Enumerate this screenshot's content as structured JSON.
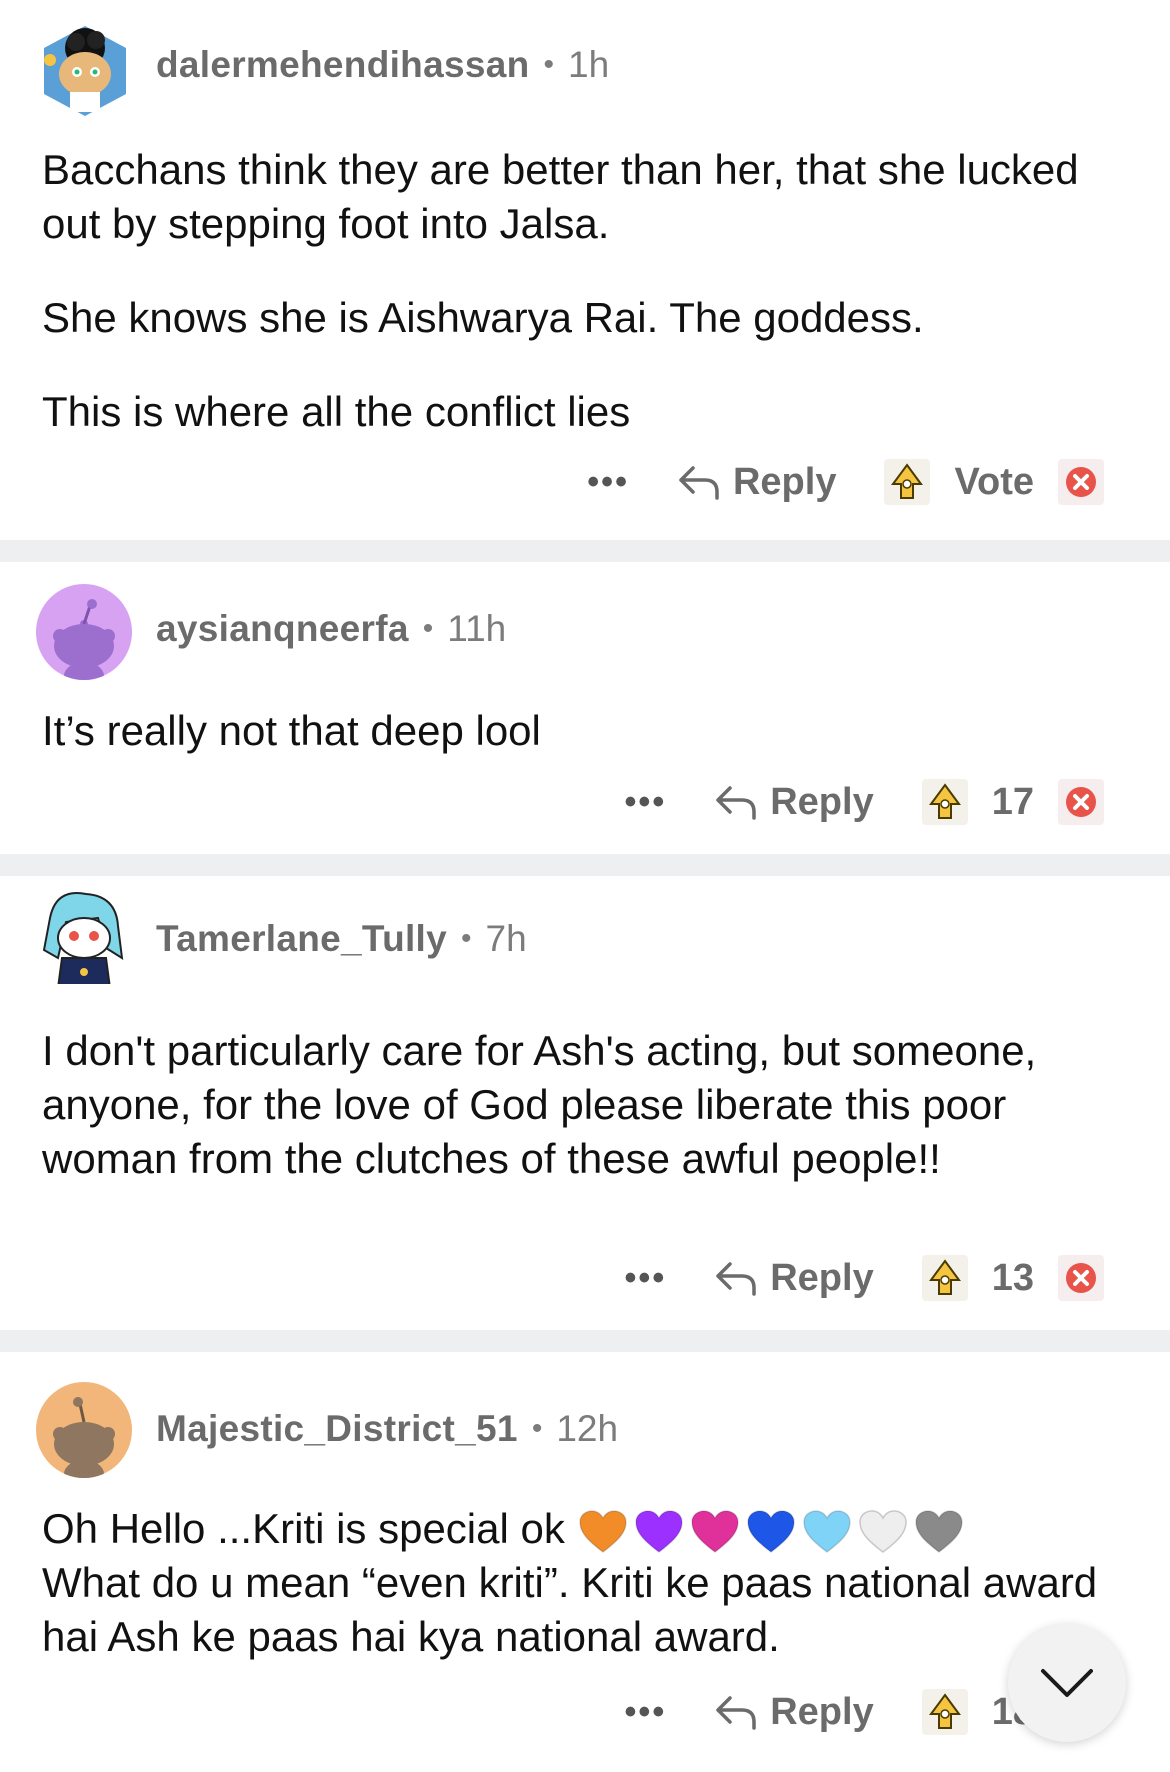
{
  "comments": [
    {
      "username": "dalermehendihassan",
      "time": "1h",
      "body": [
        "Bacchans think they are better than her, that she lucked out by stepping foot into Jalsa.",
        "She knows she is Aishwarya Rai. The goddess.",
        "This is where all the conflict lies"
      ],
      "reply_label": "Reply",
      "score": "Vote"
    },
    {
      "username": "aysianqneerfa",
      "time": "11h",
      "body": [
        "It’s really not that deep lool"
      ],
      "reply_label": "Reply",
      "score": "17"
    },
    {
      "username": "Tamerlane_Tully",
      "time": "7h",
      "body": [
        "I don't particularly care for Ash's acting, but someone, anyone, for the love of God please liberate this poor woman from the clutches of these awful people!!"
      ],
      "reply_label": "Reply",
      "score": "13"
    },
    {
      "username": "Majestic_District_51",
      "time": "12h",
      "body_line1": "Oh Hello ...Kriti is special ok",
      "body_rest": "What do u mean “even kriti”. Kriti ke paas national award hai Ash ke paas hai kya national award.",
      "reply_label": "Reply",
      "score": "18"
    }
  ],
  "more_glyph": "•••",
  "separator_dot": "•",
  "heart_colors": [
    "#f28c28",
    "#9b30ff",
    "#e0309a",
    "#1e56e8",
    "#7fd3f7",
    "#eeeeee",
    "#8a8a8a"
  ],
  "icons": [
    "reply-arrow-icon",
    "upvote-icon",
    "downvote-icon",
    "collapse-chevron-icon",
    "more-options-icon"
  ]
}
